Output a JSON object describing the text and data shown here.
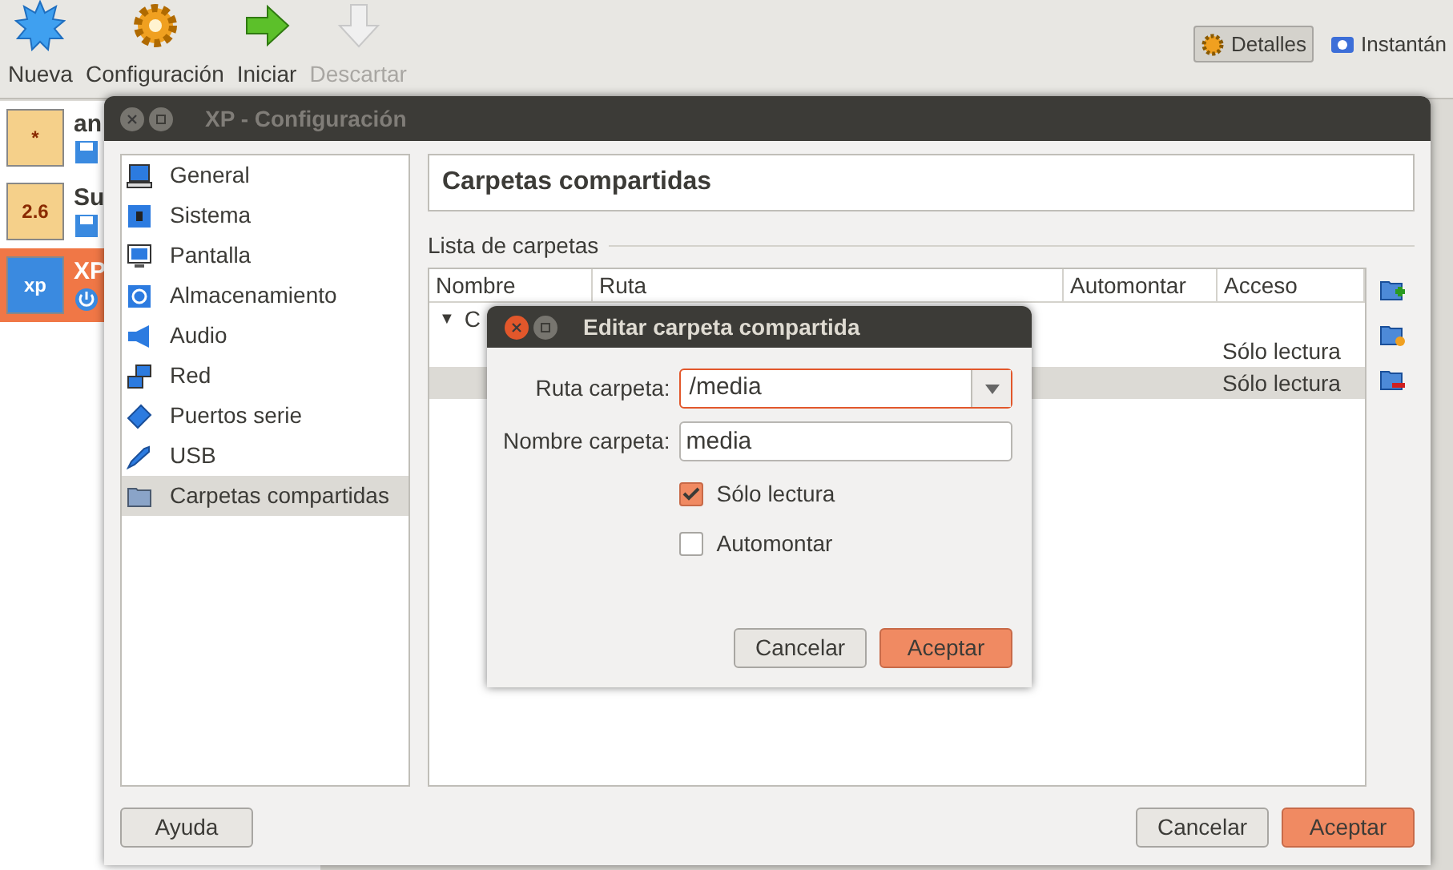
{
  "toolbar": {
    "actions": [
      {
        "label": "Nueva",
        "kind": "new",
        "disabled": false
      },
      {
        "label": "Configuración",
        "kind": "settings",
        "disabled": false
      },
      {
        "label": "Iniciar",
        "kind": "start",
        "disabled": false
      },
      {
        "label": "Descartar",
        "kind": "discard",
        "disabled": true
      }
    ],
    "views": [
      {
        "label": "Detalles",
        "kind": "details",
        "selected": true
      },
      {
        "label": "Instantán",
        "kind": "snapshots",
        "selected": false
      }
    ]
  },
  "vm_list": [
    {
      "name": "an",
      "badge": "*",
      "kind": "saved",
      "selected": false
    },
    {
      "name": "Su",
      "badge": "2.6",
      "kind": "saved",
      "selected": false
    },
    {
      "name": "XP",
      "badge": "xp",
      "kind": "running",
      "selected": true
    }
  ],
  "settings": {
    "title": "XP - Configuración",
    "sidebar": [
      {
        "label": "General",
        "kind": "general",
        "selected": false
      },
      {
        "label": "Sistema",
        "kind": "system",
        "selected": false
      },
      {
        "label": "Pantalla",
        "kind": "display",
        "selected": false
      },
      {
        "label": "Almacenamiento",
        "kind": "storage",
        "selected": false
      },
      {
        "label": "Audio",
        "kind": "audio",
        "selected": false
      },
      {
        "label": "Red",
        "kind": "network",
        "selected": false
      },
      {
        "label": "Puertos serie",
        "kind": "serial",
        "selected": false
      },
      {
        "label": "USB",
        "kind": "usb",
        "selected": false
      },
      {
        "label": "Carpetas compartidas",
        "kind": "folder",
        "selected": true
      }
    ],
    "page_title": "Carpetas compartidas",
    "section": "Lista de carpetas",
    "table": {
      "columns": [
        "Nombre",
        "Ruta",
        "Automontar",
        "Acceso"
      ],
      "rows": [
        {
          "expander": "▼",
          "name": "C",
          "access": "",
          "selected": false
        },
        {
          "expander": "",
          "name": "",
          "access": "Sólo lectura",
          "selected": false
        },
        {
          "expander": "",
          "name": "",
          "access": "Sólo lectura",
          "selected": true
        }
      ]
    },
    "side_tools": [
      {
        "kind": "add"
      },
      {
        "kind": "edit"
      },
      {
        "kind": "remove"
      }
    ],
    "buttons": [
      {
        "label": "Ayuda",
        "primary": false
      },
      {
        "label": "Cancelar",
        "primary": false
      },
      {
        "label": "Aceptar",
        "primary": true
      }
    ]
  },
  "dialog": {
    "title": "Editar carpeta compartida",
    "path_label": "Ruta carpeta:",
    "path_value": "/media",
    "name_label": "Nombre carpeta:",
    "name_value": "media",
    "options": [
      {
        "label": "Sólo lectura",
        "checked": true
      },
      {
        "label": "Automontar",
        "checked": false
      }
    ],
    "buttons": [
      {
        "label": "Cancelar",
        "primary": false
      },
      {
        "label": "Aceptar",
        "primary": true
      }
    ]
  }
}
